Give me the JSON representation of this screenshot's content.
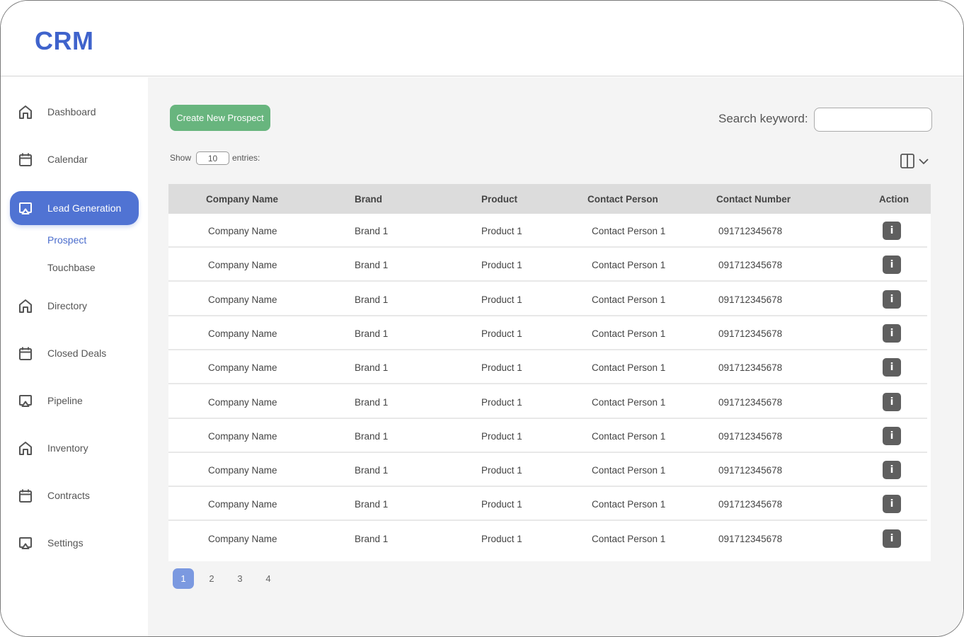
{
  "app": {
    "logo": "CRM"
  },
  "colors": {
    "brand": "#3f63cc",
    "active_nav": "#5073d3",
    "create_button": "#68b57e",
    "active_page": "#7b99e0",
    "info_button": "#5f5f5f"
  },
  "sidebar": {
    "items": [
      {
        "label": "Dashboard",
        "icon": "home-icon"
      },
      {
        "label": "Calendar",
        "icon": "calendar-icon"
      },
      {
        "label": "Lead Generation",
        "icon": "cast-icon",
        "active": true
      },
      {
        "label": "Directory",
        "icon": "home-icon"
      },
      {
        "label": "Closed Deals",
        "icon": "calendar-icon"
      },
      {
        "label": "Pipeline",
        "icon": "cast-icon"
      },
      {
        "label": "Inventory",
        "icon": "home-icon"
      },
      {
        "label": "Contracts",
        "icon": "calendar-icon"
      },
      {
        "label": "Settings",
        "icon": "cast-icon"
      }
    ],
    "sub_items": [
      {
        "label": "Prospect",
        "active": true
      },
      {
        "label": "Touchbase"
      }
    ]
  },
  "toolbar": {
    "create_label": "Create New Prospect",
    "search_label": "Search keyword:",
    "search_value": "",
    "show_label": "Show",
    "entries_value": "10",
    "entries_label": "entries:"
  },
  "table": {
    "columns": [
      "Company Name",
      "Brand",
      "Product",
      "Contact Person",
      "Contact Number",
      "Action"
    ],
    "rows": [
      [
        "Company Name",
        "Brand 1",
        "Product 1",
        "Contact Person 1",
        "091712345678"
      ],
      [
        "Company Name",
        "Brand 1",
        "Product 1",
        "Contact Person 1",
        "091712345678"
      ],
      [
        "Company Name",
        "Brand 1",
        "Product 1",
        "Contact Person 1",
        "091712345678"
      ],
      [
        "Company Name",
        "Brand 1",
        "Product 1",
        "Contact Person 1",
        "091712345678"
      ],
      [
        "Company Name",
        "Brand 1",
        "Product 1",
        "Contact Person 1",
        "091712345678"
      ],
      [
        "Company Name",
        "Brand 1",
        "Product 1",
        "Contact Person 1",
        "091712345678"
      ],
      [
        "Company Name",
        "Brand 1",
        "Product 1",
        "Contact Person 1",
        "091712345678"
      ],
      [
        "Company Name",
        "Brand 1",
        "Product 1",
        "Contact Person 1",
        "091712345678"
      ],
      [
        "Company Name",
        "Brand 1",
        "Product 1",
        "Contact Person 1",
        "091712345678"
      ],
      [
        "Company Name",
        "Brand 1",
        "Product 1",
        "Contact Person 1",
        "091712345678"
      ]
    ],
    "action_label": "i"
  },
  "pagination": {
    "pages": [
      "1",
      "2",
      "3",
      "4"
    ],
    "current": "1"
  }
}
